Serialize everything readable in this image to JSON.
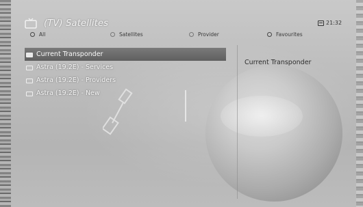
{
  "header": {
    "title": "(TV) Satellites",
    "icon": "tv-icon",
    "clock": "21:32",
    "clock_icon": "clock-icon"
  },
  "filters": [
    {
      "label": "All",
      "selected": true
    },
    {
      "label": "Satellites",
      "selected": false
    },
    {
      "label": "Provider",
      "selected": false
    },
    {
      "label": "Favourites",
      "selected": false
    }
  ],
  "list": {
    "items": [
      {
        "label": "Current Transponder",
        "selected": true
      },
      {
        "label": "Astra (19.2E) - Services",
        "selected": false
      },
      {
        "label": "Astra (19.2E) - Providers",
        "selected": false
      },
      {
        "label": "Astra (19.2E) - New",
        "selected": false
      }
    ]
  },
  "panel": {
    "title": "Current Transponder"
  },
  "colors": {
    "highlight": "#6a6a6a",
    "text_light": "#f7f7f7",
    "text_dark": "#2e2e2e",
    "background": "#bdbdbd"
  }
}
